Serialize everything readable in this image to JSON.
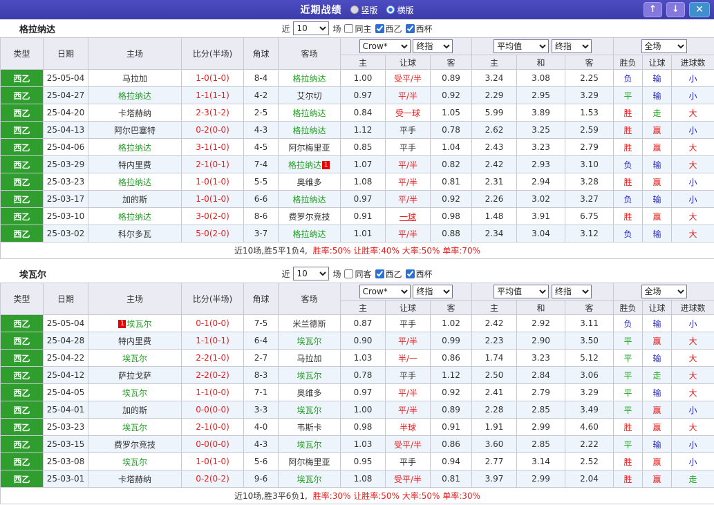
{
  "titlebar": {
    "title": "近期战绩",
    "view_modes": [
      {
        "label": "竖版",
        "selected": false
      },
      {
        "label": "横版",
        "selected": true
      }
    ],
    "up_icon": "↑",
    "down_icon": "↓",
    "close_icon": "✕"
  },
  "filter_labels": {
    "recent": "近",
    "games": "场",
    "league": "西乙",
    "cup": "西杯"
  },
  "dropdowns": {
    "bookmaker": "Crow*",
    "final": "终指",
    "average": "平均值",
    "fulltime": "全场"
  },
  "columns": {
    "type": "类型",
    "date": "日期",
    "home": "主场",
    "score": "比分(半场)",
    "corner": "角球",
    "away": "客场",
    "sub": [
      "主",
      "让球",
      "客",
      "主",
      "和",
      "客",
      "胜负",
      "让球",
      "进球数"
    ]
  },
  "sections": [
    {
      "team": "格拉纳达",
      "filter": {
        "count": "10",
        "same_label": "同主",
        "same_checked": false,
        "league_checked": true,
        "cup_checked": true
      },
      "rows": [
        {
          "league": "西乙",
          "date": "25-05-04",
          "home": "马拉加",
          "away": "格拉纳达",
          "focus": "away",
          "score": "1-0(1-0)",
          "corner": "8-4",
          "asia": [
            "1.00",
            "受平/半",
            "0.89"
          ],
          "europe": [
            "3.24",
            "3.08",
            "2.25"
          ],
          "results": [
            "负",
            "输",
            "小"
          ]
        },
        {
          "league": "西乙",
          "date": "25-04-27",
          "home": "格拉纳达",
          "away": "艾尔切",
          "focus": "home",
          "score": "1-1(1-1)",
          "corner": "4-2",
          "asia": [
            "0.97",
            "平/半",
            "0.92"
          ],
          "europe": [
            "2.29",
            "2.95",
            "3.29"
          ],
          "results": [
            "平",
            "输",
            "小"
          ]
        },
        {
          "league": "西乙",
          "date": "25-04-20",
          "home": "卡塔赫纳",
          "away": "格拉纳达",
          "focus": "away",
          "score": "2-3(1-2)",
          "corner": "2-5",
          "asia": [
            "0.84",
            "受一球",
            "1.05"
          ],
          "europe": [
            "5.99",
            "3.89",
            "1.53"
          ],
          "results": [
            "胜",
            "走",
            "大"
          ]
        },
        {
          "league": "西乙",
          "date": "25-04-13",
          "home": "阿尔巴塞特",
          "away": "格拉纳达",
          "focus": "away",
          "score": "0-2(0-0)",
          "corner": "4-3",
          "asia": [
            "1.12",
            "平手",
            "0.78"
          ],
          "europe": [
            "2.62",
            "3.25",
            "2.59"
          ],
          "results": [
            "胜",
            "赢",
            "小"
          ]
        },
        {
          "league": "西乙",
          "date": "25-04-06",
          "home": "格拉纳达",
          "away": "阿尔梅里亚",
          "focus": "home",
          "score": "3-1(1-0)",
          "corner": "4-5",
          "asia": [
            "0.85",
            "平手",
            "1.04"
          ],
          "europe": [
            "2.43",
            "3.23",
            "2.79"
          ],
          "results": [
            "胜",
            "赢",
            "大"
          ]
        },
        {
          "league": "西乙",
          "date": "25-03-29",
          "home": "特内里费",
          "away": "格拉纳达",
          "focus": "away",
          "badge": "1",
          "badge_at": "away",
          "score": "2-1(0-1)",
          "corner": "7-4",
          "asia": [
            "1.07",
            "平/半",
            "0.82"
          ],
          "europe": [
            "2.42",
            "2.93",
            "3.10"
          ],
          "results": [
            "负",
            "输",
            "大"
          ]
        },
        {
          "league": "西乙",
          "date": "25-03-23",
          "home": "格拉纳达",
          "away": "奥维多",
          "focus": "home",
          "score": "1-0(1-0)",
          "corner": "5-5",
          "asia": [
            "1.08",
            "平/半",
            "0.81"
          ],
          "europe": [
            "2.31",
            "2.94",
            "3.28"
          ],
          "results": [
            "胜",
            "赢",
            "小"
          ]
        },
        {
          "league": "西乙",
          "date": "25-03-17",
          "home": "加的斯",
          "away": "格拉纳达",
          "focus": "away",
          "score": "1-0(1-0)",
          "corner": "6-6",
          "asia": [
            "0.97",
            "平/半",
            "0.92"
          ],
          "europe": [
            "2.26",
            "3.02",
            "3.27"
          ],
          "results": [
            "负",
            "输",
            "小"
          ]
        },
        {
          "league": "西乙",
          "date": "25-03-10",
          "home": "格拉纳达",
          "away": "费罗尔竞技",
          "focus": "home",
          "score": "3-0(2-0)",
          "corner": "8-6",
          "asia": [
            "0.91",
            "一球",
            "0.98"
          ],
          "underline": true,
          "europe": [
            "1.48",
            "3.91",
            "6.75"
          ],
          "results": [
            "胜",
            "赢",
            "大"
          ]
        },
        {
          "league": "西乙",
          "date": "25-03-02",
          "home": "科尔多瓦",
          "away": "格拉纳达",
          "focus": "away",
          "score": "5-0(2-0)",
          "corner": "3-7",
          "asia": [
            "1.01",
            "平/半",
            "0.88"
          ],
          "europe": [
            "2.34",
            "3.04",
            "3.12"
          ],
          "results": [
            "负",
            "输",
            "大"
          ]
        }
      ],
      "summary": {
        "prefix": "近10场,胜5平1负4,",
        "stats": "胜率:50% 让胜率:40% 大率:50% 单率:70%"
      }
    },
    {
      "team": "埃瓦尔",
      "filter": {
        "count": "10",
        "same_label": "同客",
        "same_checked": false,
        "league_checked": true,
        "cup_checked": true
      },
      "rows": [
        {
          "league": "西乙",
          "date": "25-05-04",
          "home": "埃瓦尔",
          "away": "米兰德斯",
          "focus": "home",
          "badge": "1",
          "badge_at": "home",
          "score": "0-1(0-0)",
          "corner": "7-5",
          "asia": [
            "0.87",
            "平手",
            "1.02"
          ],
          "europe": [
            "2.42",
            "2.92",
            "3.11"
          ],
          "results": [
            "负",
            "输",
            "小"
          ]
        },
        {
          "league": "西乙",
          "date": "25-04-28",
          "home": "特内里费",
          "away": "埃瓦尔",
          "focus": "away",
          "score": "1-1(0-1)",
          "corner": "6-4",
          "asia": [
            "0.90",
            "平/半",
            "0.99"
          ],
          "europe": [
            "2.23",
            "2.90",
            "3.50"
          ],
          "results": [
            "平",
            "赢",
            "大"
          ]
        },
        {
          "league": "西乙",
          "date": "25-04-22",
          "home": "埃瓦尔",
          "away": "马拉加",
          "focus": "home",
          "score": "2-2(1-0)",
          "corner": "2-7",
          "asia": [
            "1.03",
            "半/一",
            "0.86"
          ],
          "europe": [
            "1.74",
            "3.23",
            "5.12"
          ],
          "results": [
            "平",
            "输",
            "大"
          ]
        },
        {
          "league": "西乙",
          "date": "25-04-12",
          "home": "萨拉戈萨",
          "away": "埃瓦尔",
          "focus": "away",
          "score": "2-2(0-2)",
          "corner": "8-3",
          "asia": [
            "0.78",
            "平手",
            "1.12"
          ],
          "europe": [
            "2.50",
            "2.84",
            "3.06"
          ],
          "results": [
            "平",
            "走",
            "大"
          ]
        },
        {
          "league": "西乙",
          "date": "25-04-05",
          "home": "埃瓦尔",
          "away": "奥维多",
          "focus": "home",
          "score": "1-1(0-0)",
          "corner": "7-1",
          "asia": [
            "0.97",
            "平/半",
            "0.92"
          ],
          "europe": [
            "2.41",
            "2.79",
            "3.29"
          ],
          "results": [
            "平",
            "输",
            "大"
          ]
        },
        {
          "league": "西乙",
          "date": "25-04-01",
          "home": "加的斯",
          "away": "埃瓦尔",
          "focus": "away",
          "score": "0-0(0-0)",
          "corner": "3-3",
          "asia": [
            "1.00",
            "平/半",
            "0.89"
          ],
          "europe": [
            "2.28",
            "2.85",
            "3.49"
          ],
          "results": [
            "平",
            "赢",
            "小"
          ]
        },
        {
          "league": "西乙",
          "date": "25-03-23",
          "home": "埃瓦尔",
          "away": "韦斯卡",
          "focus": "home",
          "score": "2-1(0-0)",
          "corner": "4-0",
          "asia": [
            "0.98",
            "半球",
            "0.91"
          ],
          "europe": [
            "1.91",
            "2.99",
            "4.60"
          ],
          "results": [
            "胜",
            "赢",
            "大"
          ]
        },
        {
          "league": "西乙",
          "date": "25-03-15",
          "home": "费罗尔竞技",
          "away": "埃瓦尔",
          "focus": "away",
          "score": "0-0(0-0)",
          "corner": "4-3",
          "asia": [
            "1.03",
            "受平/半",
            "0.86"
          ],
          "europe": [
            "3.60",
            "2.85",
            "2.22"
          ],
          "results": [
            "平",
            "输",
            "小"
          ]
        },
        {
          "league": "西乙",
          "date": "25-03-08",
          "home": "埃瓦尔",
          "away": "阿尔梅里亚",
          "focus": "home",
          "score": "1-0(1-0)",
          "corner": "5-6",
          "asia": [
            "0.95",
            "平手",
            "0.94"
          ],
          "europe": [
            "2.77",
            "3.14",
            "2.52"
          ],
          "results": [
            "胜",
            "赢",
            "小"
          ]
        },
        {
          "league": "西乙",
          "date": "25-03-01",
          "home": "卡塔赫纳",
          "away": "埃瓦尔",
          "focus": "away",
          "score": "0-2(0-2)",
          "corner": "9-6",
          "asia": [
            "1.08",
            "受平/半",
            "0.81"
          ],
          "europe": [
            "3.97",
            "2.99",
            "2.04"
          ],
          "results": [
            "胜",
            "赢",
            "走"
          ]
        }
      ],
      "summary": {
        "prefix": "近10场,胜3平6负1,",
        "stats": "胜率:30% 让胜率:50% 大率:50% 单率:30%"
      }
    }
  ]
}
